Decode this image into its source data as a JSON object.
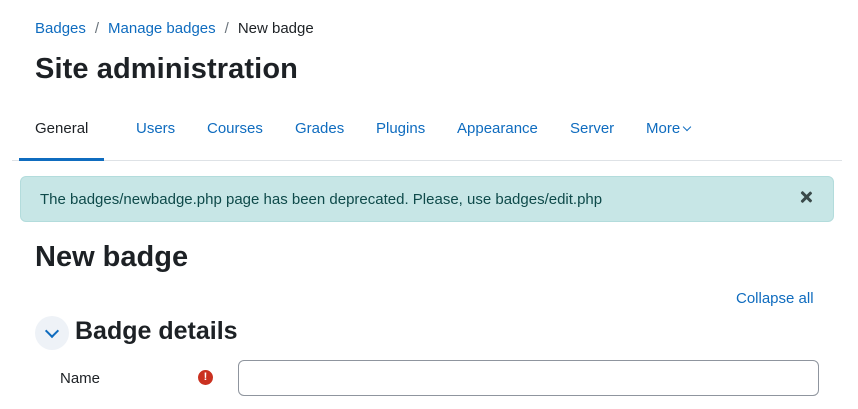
{
  "breadcrumb": {
    "items": [
      "Badges",
      "Manage badges"
    ],
    "separator": "/",
    "current": "New badge"
  },
  "page_title": "Site administration",
  "tabs": [
    {
      "label": "General",
      "active": true
    },
    {
      "label": "Users"
    },
    {
      "label": "Courses"
    },
    {
      "label": "Grades"
    },
    {
      "label": "Plugins"
    },
    {
      "label": "Appearance"
    },
    {
      "label": "Server"
    },
    {
      "label": "More"
    }
  ],
  "alert": {
    "message": "The badges/newbadge.php page has been deprecated. Please, use badges/edit.php",
    "close_icon": "close-icon"
  },
  "form": {
    "title": "New badge",
    "collapse_all": "Collapse all",
    "section": {
      "title": "Badge details",
      "toggle_icon": "chevron-down-icon"
    },
    "fields": {
      "name": {
        "label": "Name",
        "value": "",
        "required_icon": "exclamation-icon",
        "required_mark": "!"
      }
    }
  },
  "colors": {
    "link": "#0f6cbf",
    "alert_bg": "#c7e6e6",
    "required": "#ca3120"
  }
}
